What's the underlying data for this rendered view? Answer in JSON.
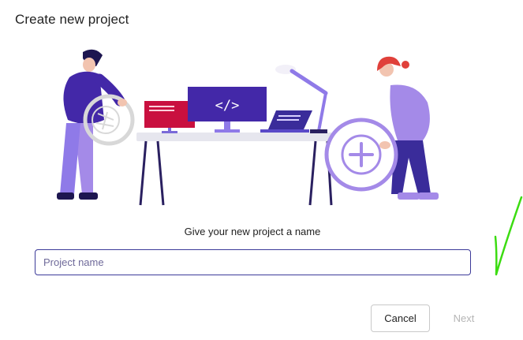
{
  "dialog": {
    "title": "Create new project",
    "prompt": "Give your new project a name",
    "input": {
      "placeholder": "Project name",
      "value": ""
    },
    "buttons": {
      "cancel": "Cancel",
      "next": "Next"
    }
  },
  "illustration": {
    "monitor_code_text": "</>"
  },
  "colors": {
    "accent": "#3c3a99",
    "purple_dark": "#4a2a9c",
    "purple_light": "#a48ae8",
    "monitor_red": "#c9103f",
    "annotation_green": "#3cdc12"
  }
}
